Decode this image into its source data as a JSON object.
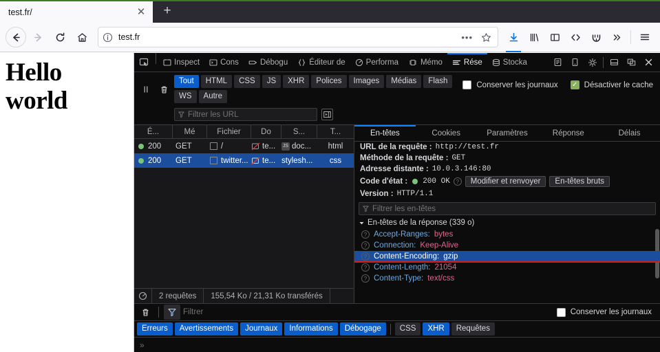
{
  "browser": {
    "tab": {
      "title": "test.fr/",
      "close_icon": "close-icon"
    },
    "newtab_label": "+",
    "nav": {
      "back_icon": "back-arrow-icon",
      "forward_icon": "forward-arrow-icon",
      "reload_icon": "reload-icon",
      "home_icon": "home-icon"
    },
    "urlbar": {
      "info_icon": "info-icon",
      "value": "test.fr",
      "dots": "•••",
      "star_icon": "star-icon"
    },
    "toolbar_icons": [
      "download-icon",
      "library-icon",
      "sidebar-icon",
      "developer-tools-icon",
      "wallet-icon",
      "overflow-chevrons-icon",
      "hamburger-menu-icon"
    ]
  },
  "page": {
    "heading": "Hello world"
  },
  "devtools": {
    "picker_icon": "element-picker-icon",
    "tabs": [
      {
        "label": "Inspect",
        "icon": "inspector-icon",
        "active": false
      },
      {
        "label": "Cons",
        "icon": "console-icon",
        "active": false
      },
      {
        "label": "Débogu",
        "icon": "debugger-icon",
        "active": false
      },
      {
        "label": "Éditeur de",
        "icon": "style-editor-icon",
        "active": false
      },
      {
        "label": "Performa",
        "icon": "performance-icon",
        "active": false
      },
      {
        "label": "Mémo",
        "icon": "memory-icon",
        "active": false
      },
      {
        "label": "Rése",
        "icon": "network-icon",
        "active": true
      },
      {
        "label": "Stocka",
        "icon": "storage-icon",
        "active": false
      }
    ],
    "right_icons": [
      "accessibility-icon",
      "responsive-design-icon",
      "settings-gear-icon",
      "dock-bottom-icon",
      "dock-separate-window-icon",
      "close-devtools-icon"
    ],
    "network": {
      "toolbar": {
        "pause_icon": "pause-icon",
        "clear_icon": "trash-icon",
        "filter_chips": [
          {
            "label": "Tout",
            "active": true
          },
          {
            "label": "HTML",
            "active": false
          },
          {
            "label": "CSS",
            "active": false
          },
          {
            "label": "JS",
            "active": false
          },
          {
            "label": "XHR",
            "active": false
          },
          {
            "label": "Polices",
            "active": false
          },
          {
            "label": "Images",
            "active": false
          },
          {
            "label": "Médias",
            "active": false
          },
          {
            "label": "Flash",
            "active": false
          },
          {
            "label": "WS",
            "active": false
          },
          {
            "label": "Autre",
            "active": false
          }
        ],
        "url_filter_placeholder": "Filtrer les URL",
        "filter_icon": "funnel-icon",
        "persist_icon": "persist-logs-toggle-icon",
        "checkboxes": [
          {
            "label": "Conserver les journaux",
            "checked": false
          },
          {
            "label": "Désactiver le cache",
            "checked": true
          }
        ]
      },
      "columns": [
        "É...",
        "Mé",
        "Fichier",
        "Do",
        "S...",
        "T..."
      ],
      "rows": [
        {
          "status": "200",
          "method": "GET",
          "file": "/",
          "domain": "te...",
          "cause": "doc...",
          "type": "html",
          "selected": false
        },
        {
          "status": "200",
          "method": "GET",
          "file": "twitter...",
          "domain": "te...",
          "cause": "stylesh...",
          "type": "css",
          "selected": true
        }
      ],
      "footer": {
        "clock_icon": "timing-icon",
        "requests": "2 requêtes",
        "transferred": "155,54 Ko / 21,31 Ko transférés"
      }
    },
    "details": {
      "tabs": [
        {
          "label": "En-têtes",
          "active": true
        },
        {
          "label": "Cookies",
          "active": false
        },
        {
          "label": "Paramètres",
          "active": false
        },
        {
          "label": "Réponse",
          "active": false
        },
        {
          "label": "Délais",
          "active": false
        }
      ],
      "fields": [
        {
          "key": "URL de la requête :",
          "value": "http://test.fr"
        },
        {
          "key": "Méthode de la requête :",
          "value": "GET"
        },
        {
          "key": "Adresse distante :",
          "value": "10.0.3.146:80"
        }
      ],
      "status": {
        "key": "Code d'état :",
        "value": "200 OK",
        "help_icon": "help-icon",
        "buttons": [
          "Modifier et renvoyer",
          "En-têtes bruts"
        ]
      },
      "version": {
        "key": "Version :",
        "value": "HTTP/1.1"
      },
      "header_filter_placeholder": "Filtrer les en-têtes",
      "section_title": "En-têtes de la réponse (339 o)",
      "headers": [
        {
          "name": "Accept-Ranges:",
          "value": "bytes",
          "selected": false
        },
        {
          "name": "Connection:",
          "value": "Keep-Alive",
          "selected": false
        },
        {
          "name": "Content-Encoding:",
          "value": "gzip",
          "selected": true
        },
        {
          "name": "Content-Length:",
          "value": "21054",
          "selected": false
        },
        {
          "name": "Content-Type:",
          "value": "text/css",
          "selected": false
        }
      ]
    },
    "console": {
      "clear_icon": "trash-icon",
      "filter_icon": "funnel-icon",
      "filter_placeholder": "Filtrer",
      "persist_checkbox": {
        "label": "Conserver les journaux",
        "checked": false
      },
      "filters": [
        {
          "label": "Erreurs",
          "active": true
        },
        {
          "label": "Avertissements",
          "active": true
        },
        {
          "label": "Journaux",
          "active": true
        },
        {
          "label": "Informations",
          "active": true
        },
        {
          "label": "Débogage",
          "active": true
        },
        {
          "label": "CSS",
          "active": false
        },
        {
          "label": "XHR",
          "active": true
        },
        {
          "label": "Requêtes",
          "active": false
        }
      ],
      "prompt": "»"
    }
  },
  "colors": {
    "accent_blue": "#0a84ff",
    "chip_active": "#0a5ecc",
    "selection": "#1b4f9e",
    "status_green": "#7ac47a",
    "underline_red": "#d81b1b"
  }
}
